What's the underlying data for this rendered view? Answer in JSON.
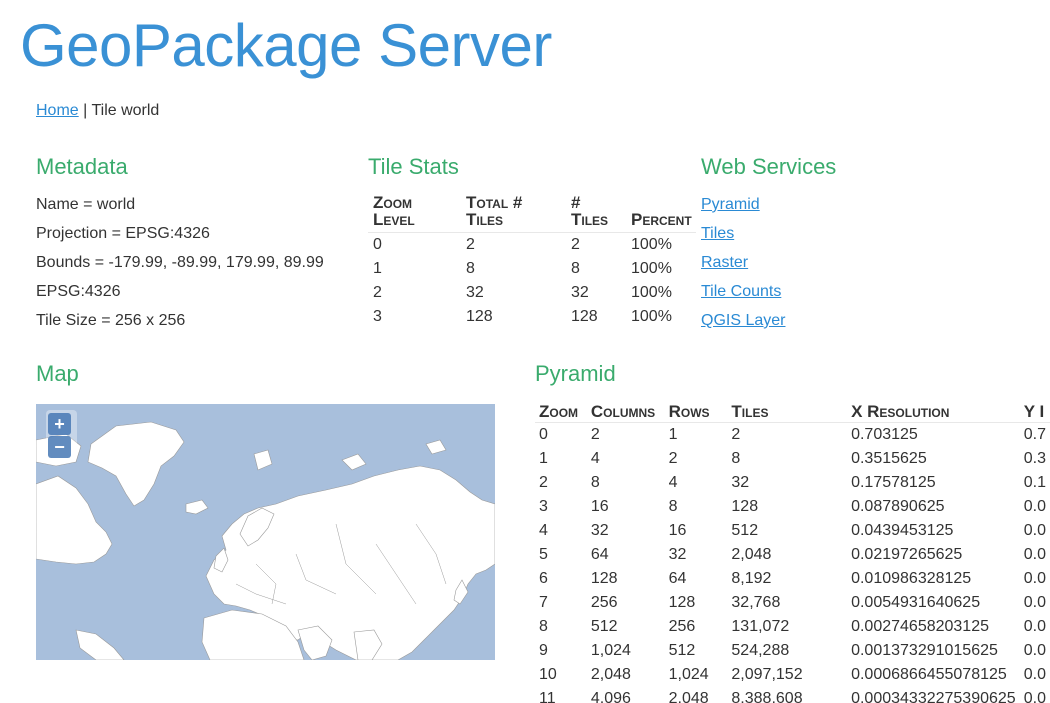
{
  "header": {
    "title": "GeoPackage Server"
  },
  "breadcrumb": {
    "home": "Home",
    "separator": "|",
    "current": "Tile world"
  },
  "metadata": {
    "title": "Metadata",
    "items": [
      "Name = world",
      "Projection = EPSG:4326",
      "Bounds = -179.99, -89.99, 179.99, 89.99",
      "EPSG:4326",
      "Tile Size = 256 x 256"
    ]
  },
  "tile_stats": {
    "title": "Tile Stats",
    "headers": [
      [
        "Zoom",
        "Level"
      ],
      [
        "Total #",
        "Tiles"
      ],
      [
        "#",
        "Tiles"
      ],
      [
        "",
        "Percent"
      ]
    ],
    "rows": [
      [
        "0",
        "2",
        "2",
        "100%"
      ],
      [
        "1",
        "8",
        "8",
        "100%"
      ],
      [
        "2",
        "32",
        "32",
        "100%"
      ],
      [
        "3",
        "128",
        "128",
        "100%"
      ]
    ]
  },
  "web_services": {
    "title": "Web Services",
    "links": [
      "Pyramid",
      "Tiles",
      "Raster",
      "Tile Counts",
      "QGIS Layer"
    ]
  },
  "map": {
    "title": "Map",
    "zoom_in": "+",
    "zoom_out": "−",
    "colors": {
      "ocean": "#a8bfdc",
      "land": "#ffffff",
      "borders": "#9a9a9a"
    }
  },
  "pyramid": {
    "title": "Pyramid",
    "headers": [
      "Zoom",
      "Columns",
      "Rows",
      "Tiles",
      "X Resolution",
      "Y I"
    ],
    "rows": [
      [
        "0",
        "2",
        "1",
        "2",
        "0.703125",
        "0.7"
      ],
      [
        "1",
        "4",
        "2",
        "8",
        "0.3515625",
        "0.3"
      ],
      [
        "2",
        "8",
        "4",
        "32",
        "0.17578125",
        "0.1"
      ],
      [
        "3",
        "16",
        "8",
        "128",
        "0.087890625",
        "0.0"
      ],
      [
        "4",
        "32",
        "16",
        "512",
        "0.0439453125",
        "0.0"
      ],
      [
        "5",
        "64",
        "32",
        "2,048",
        "0.02197265625",
        "0.0"
      ],
      [
        "6",
        "128",
        "64",
        "8,192",
        "0.010986328125",
        "0.0"
      ],
      [
        "7",
        "256",
        "128",
        "32,768",
        "0.0054931640625",
        "0.0"
      ],
      [
        "8",
        "512",
        "256",
        "131,072",
        "0.00274658203125",
        "0.0"
      ],
      [
        "9",
        "1,024",
        "512",
        "524,288",
        "0.001373291015625",
        "0.0"
      ],
      [
        "10",
        "2,048",
        "1,024",
        "2,097,152",
        "0.0006866455078125",
        "0.0"
      ],
      [
        "11",
        "4,096",
        "2,048",
        "8,388,608",
        "0.00034332275390625",
        "0.0"
      ]
    ]
  },
  "colors": {
    "title": "#3a91d5",
    "section": "#3aab6d",
    "link": "#2a8ad4"
  }
}
